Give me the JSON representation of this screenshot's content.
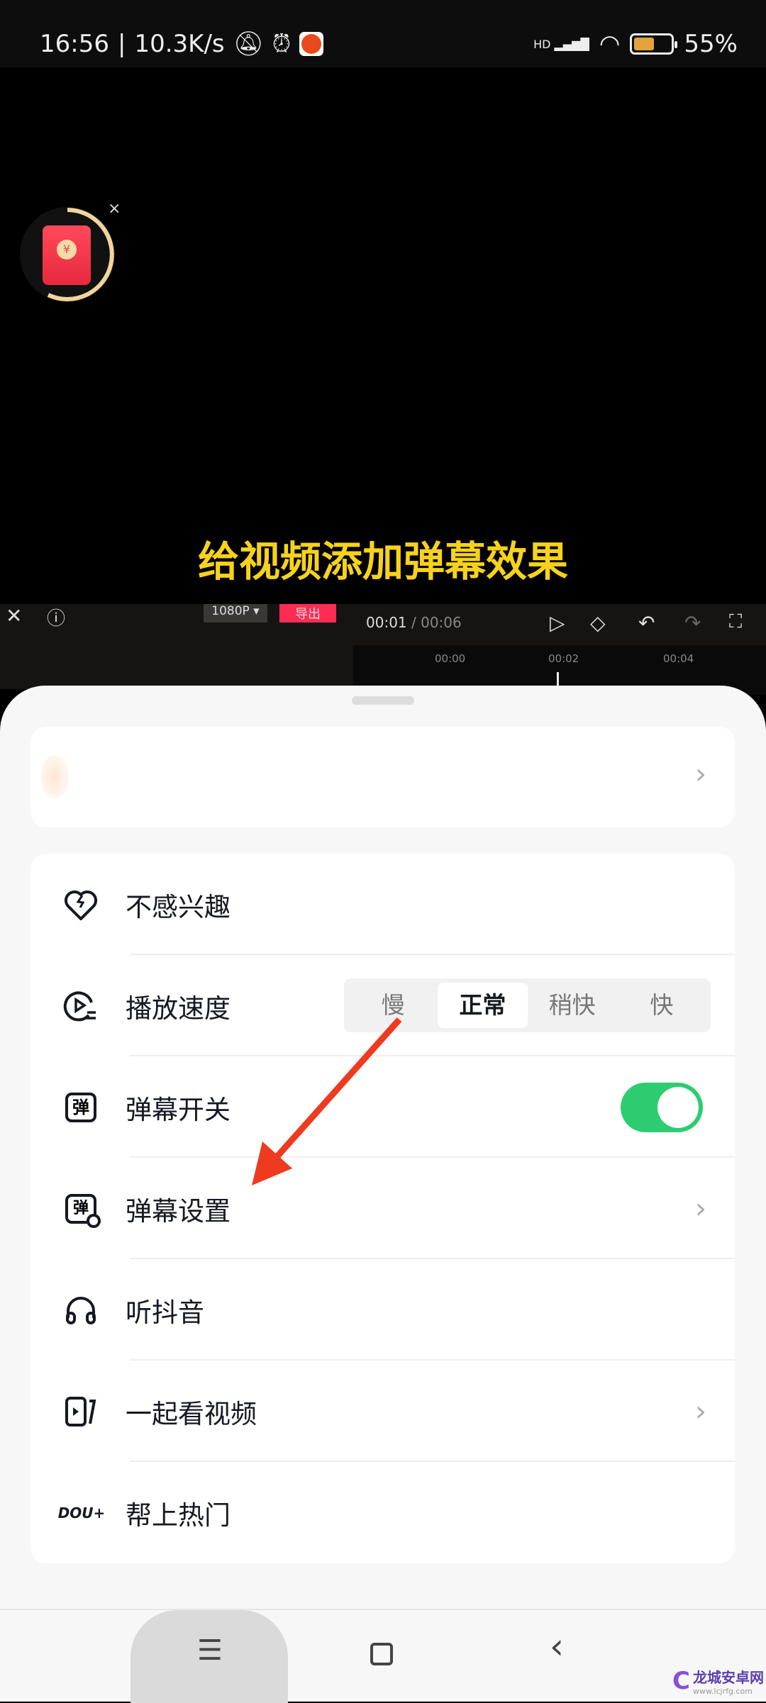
{
  "status_bar": {
    "time": "16:56",
    "speed": "10.3K/s",
    "network": "HD",
    "battery_level": 55,
    "battery_text": "55%"
  },
  "video": {
    "subtitle": "给视频添加弹幕效果",
    "red_packet_symbol": "¥",
    "close_symbol": "×"
  },
  "editor": {
    "resolution": "1080P ▾",
    "export": "导出",
    "time_current": "00:01",
    "time_total": "/ 00:06",
    "ticks": [
      "00:00",
      "00:02",
      "00:04"
    ]
  },
  "menu": {
    "items": [
      {
        "label": "不感兴趣",
        "icon": "broken-heart-icon"
      },
      {
        "label": "播放速度",
        "icon": "play-speed-icon",
        "speed_options": [
          "慢",
          "正常",
          "稍快",
          "快"
        ],
        "selected": "正常"
      },
      {
        "label": "弹幕开关",
        "icon": "danmaku-icon",
        "toggle_on": true
      },
      {
        "label": "弹幕设置",
        "icon": "danmaku-settings-icon",
        "chevron": true
      },
      {
        "label": "听抖音",
        "icon": "headphones-icon"
      },
      {
        "label": "一起看视频",
        "icon": "watch-together-icon",
        "chevron": true
      },
      {
        "label": "帮上热门",
        "icon": "dou-plus-icon",
        "icon_text": "DOU+"
      }
    ]
  },
  "watermark": {
    "name": "龙城安卓网",
    "url": "www.lcjrfg.com"
  },
  "colors": {
    "accent_toggle": "#2ecc71",
    "subtitle": "#f7d21c",
    "export": "#fe2c55",
    "arrow": "#ee3a1f"
  }
}
